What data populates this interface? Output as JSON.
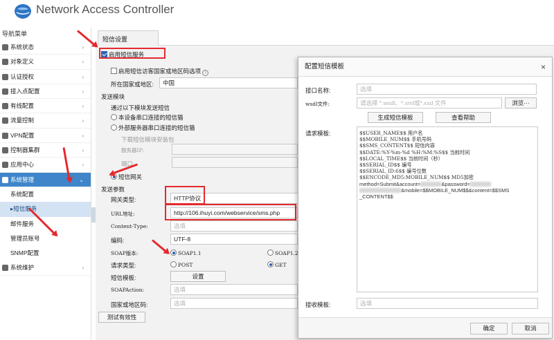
{
  "app": {
    "title": "Network Access Controller"
  },
  "sidebar": {
    "header": "导航菜单",
    "items": [
      {
        "label": "系统状态",
        "icon": "monitor-icon"
      },
      {
        "label": "对象定义",
        "icon": "object-icon"
      },
      {
        "label": "认证授权",
        "icon": "user-auth-icon"
      },
      {
        "label": "接入点配置",
        "icon": "access-point-icon"
      },
      {
        "label": "有线配置",
        "icon": "wired-icon"
      },
      {
        "label": "流量控制",
        "icon": "traffic-icon"
      },
      {
        "label": "VPN配置",
        "icon": "vpn-icon"
      },
      {
        "label": "控制器集群",
        "icon": "cluster-icon"
      },
      {
        "label": "应用中心",
        "icon": "app-center-icon"
      },
      {
        "label": "系统管理",
        "icon": "system-manage-icon"
      }
    ],
    "sub_items": [
      "系统配置",
      "▸短信服务",
      "邮件服务",
      "管理员账号",
      "SNMP配置"
    ],
    "bottom_item": {
      "label": "系统维护",
      "icon": "maintenance-icon"
    }
  },
  "tab": {
    "label": "短信设置"
  },
  "form": {
    "enable_sms": "启用短信服务",
    "intl_option": "启用短信访客国家或地区码选项",
    "country_label": "所在国家或地区:",
    "country_value": "中国",
    "send_module_title": "发送模块",
    "send_via": "通过以下模块发送短信",
    "local_serial": "本设备串口连接的短信猫",
    "external_serial": "外部服务器串口连接的短信猫",
    "download_pkg": "下载短信模块安装包",
    "server_ip": "服务器IP:",
    "port": "端口:",
    "sms_gateway": "短信网关",
    "send_params_title": "发送参数",
    "gateway_type_label": "网关类型:",
    "gateway_type_value": "HTTP协议",
    "url_label": "URL地址:",
    "url_value": "http://106.ihuyi.com/webservice/sms.php",
    "content_type_label": "Content-Type:",
    "content_type_ph": "选填",
    "encoding_label": "编码:",
    "encoding_value": "UTF-8",
    "soap_version_label": "SOAP版本:",
    "soap11": "SOAP1.1",
    "soap12": "SOAP1.2",
    "request_type_label": "请求类型:",
    "post": "POST",
    "get": "GET",
    "sms_template_label": "短信模板:",
    "settings_button": "设置",
    "soap_action_label": "SOAPAction:",
    "soap_action_ph": "选填",
    "country_code_label": "国家或地区码:",
    "country_code_ph": "选填",
    "test_button": "测试有效性"
  },
  "dialog": {
    "title": "配置短信模板",
    "close": "×",
    "api_name_label": "接口名称:",
    "api_name_ph": "选填",
    "wsdl_label": "wsdl文件:",
    "wsdl_ph": "请选择 *.wsdl、*.xml或*.xsd 文件",
    "browse_button": "浏览···",
    "generate_button": "生成短信模板",
    "help_button": "查看帮助",
    "request_template_label": "请求模板:",
    "template_lines": [
      "$$USER_NAME$$ 用户名",
      "$$MOBILE_NUM$$ 手机号码",
      "$$SMS_CONTENT$$ 短信内容",
      "$$DATE:%Y-%m-%d %H:%M:%S$$ 当前时间",
      "$$LOCAL_TIME$$ 当前时间（秒）",
      "$$SERIAL_ID$$ 编号",
      "$$SERIAL_ID:6$$ 编号位数",
      "$$ENCODE_MD5:MOBILE_NUM$$ MD5加密"
    ],
    "template_body_1": "method=Submit&account=",
    "template_body_1b": "&password=",
    "template_body_2": "&mobile=$$MOBILE_NUM$$&content=$$SMS",
    "template_body_3": "_CONTENT$$",
    "receive_template_label": "接收模板:",
    "receive_template_ph": "选填",
    "ok_button": "确定",
    "cancel_button": "取消"
  },
  "colors": {
    "accent": "#3e86c9",
    "annotation": "#e5282d",
    "selected_sub": "#d4e3f3"
  }
}
